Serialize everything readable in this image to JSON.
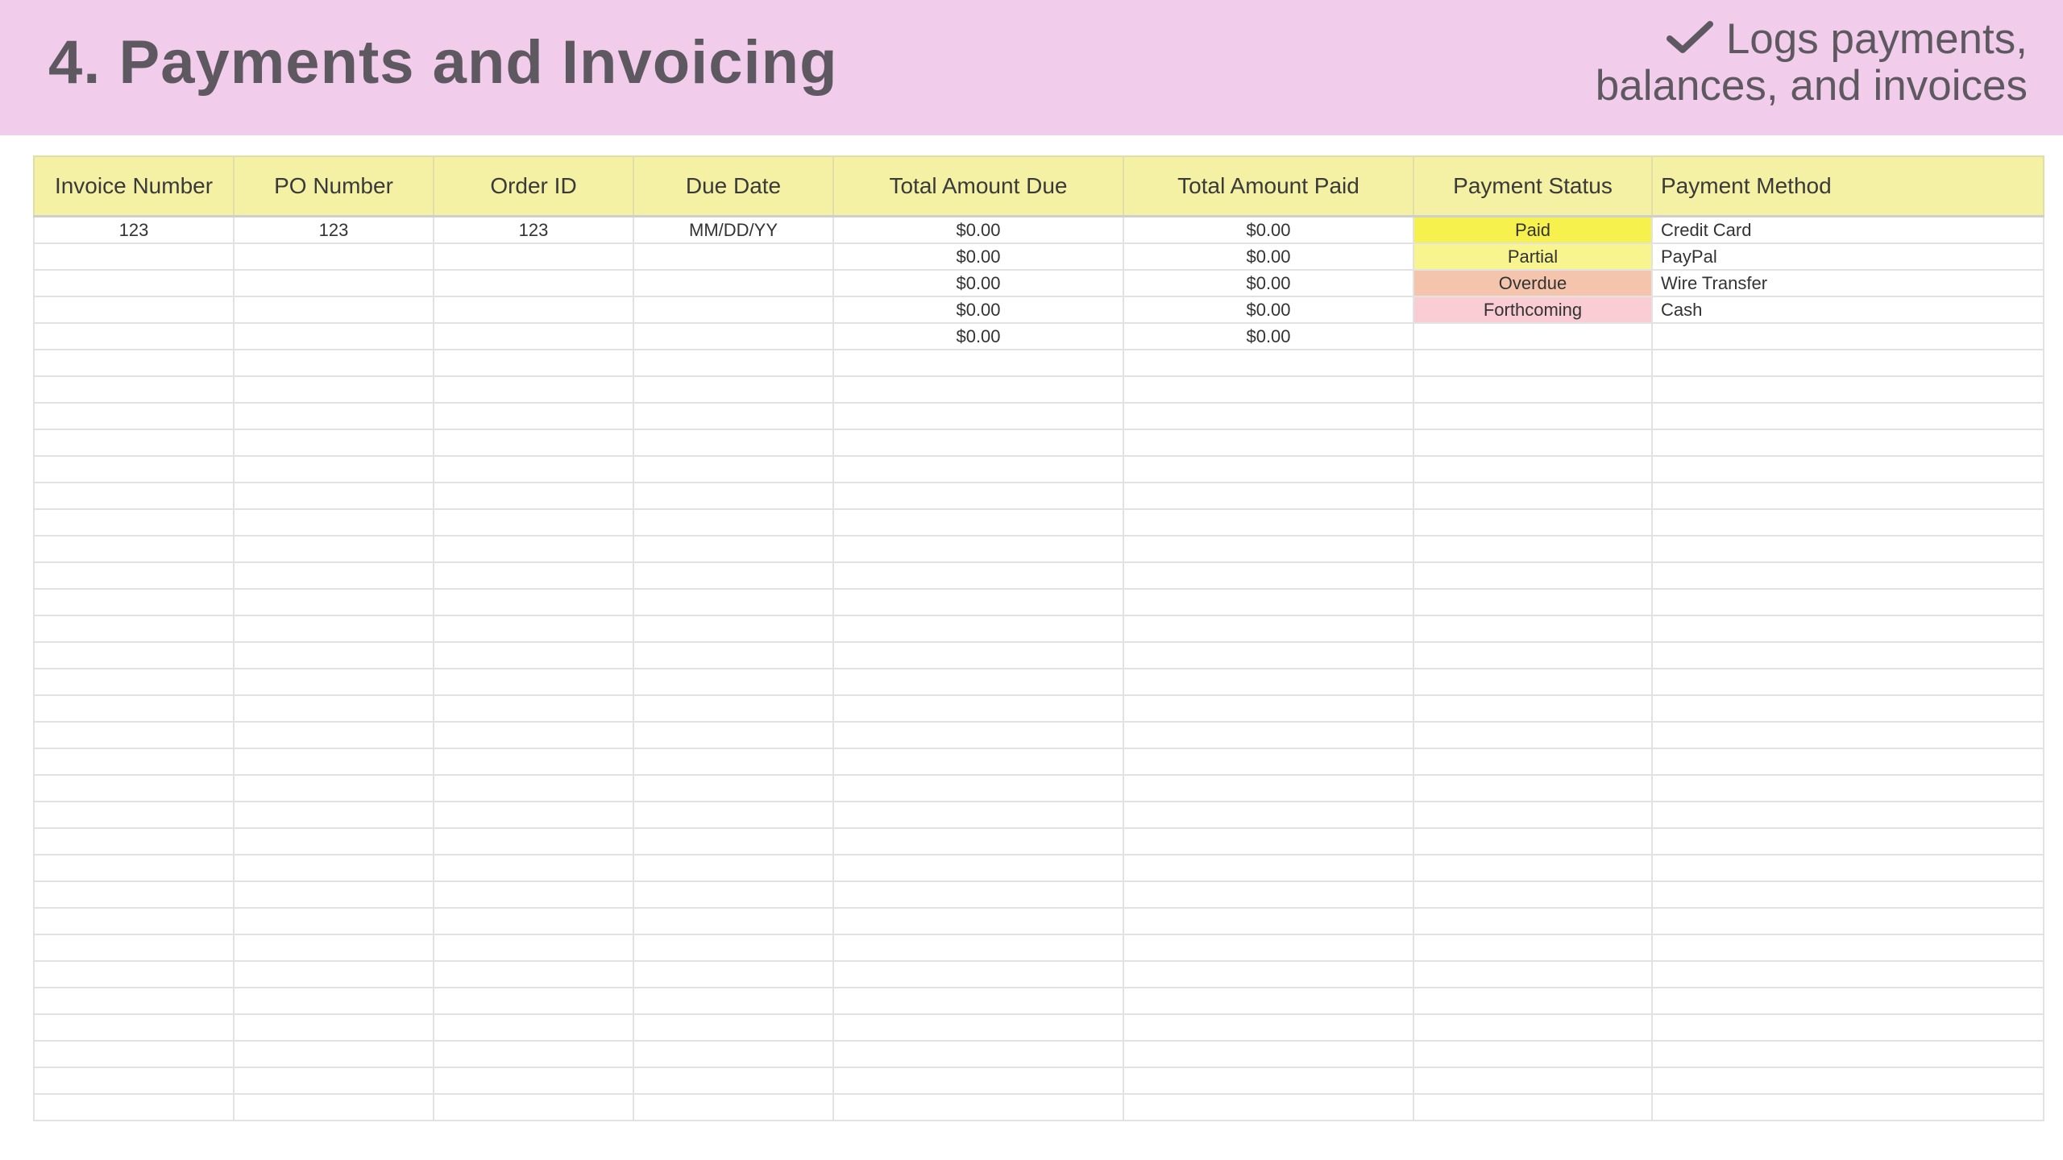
{
  "header": {
    "title": "4. Payments and Invoicing",
    "tagline_line1": "Logs payments,",
    "tagline_line2": "balances, and invoices",
    "icon": "check-icon",
    "background": "#f2cdeb"
  },
  "table": {
    "columns": [
      "Invoice Number",
      "PO Number",
      "Order ID",
      "Due Date",
      "Total Amount Due",
      "Total Amount Paid",
      "Payment Status",
      "Payment Method"
    ],
    "header_color": "#f4f0a4",
    "rows": [
      [
        "123",
        "123",
        "123",
        "MM/DD/YY",
        "$0.00",
        "$0.00",
        "Paid",
        "Credit Card"
      ],
      [
        "",
        "",
        "",
        "",
        "$0.00",
        "$0.00",
        "Partial",
        "PayPal"
      ],
      [
        "",
        "",
        "",
        "",
        "$0.00",
        "$0.00",
        "Overdue",
        "Wire Transfer"
      ],
      [
        "",
        "",
        "",
        "",
        "$0.00",
        "$0.00",
        "Forthcoming",
        "Cash"
      ],
      [
        "",
        "",
        "",
        "",
        "$0.00",
        "$0.00",
        "",
        ""
      ]
    ],
    "total_rows": 34,
    "status_colors": {
      "Paid": "#f6f14d",
      "Partial": "#f9f58e",
      "Overdue": "#f4c4ad",
      "Forthcoming": "#f9cdd3"
    }
  }
}
